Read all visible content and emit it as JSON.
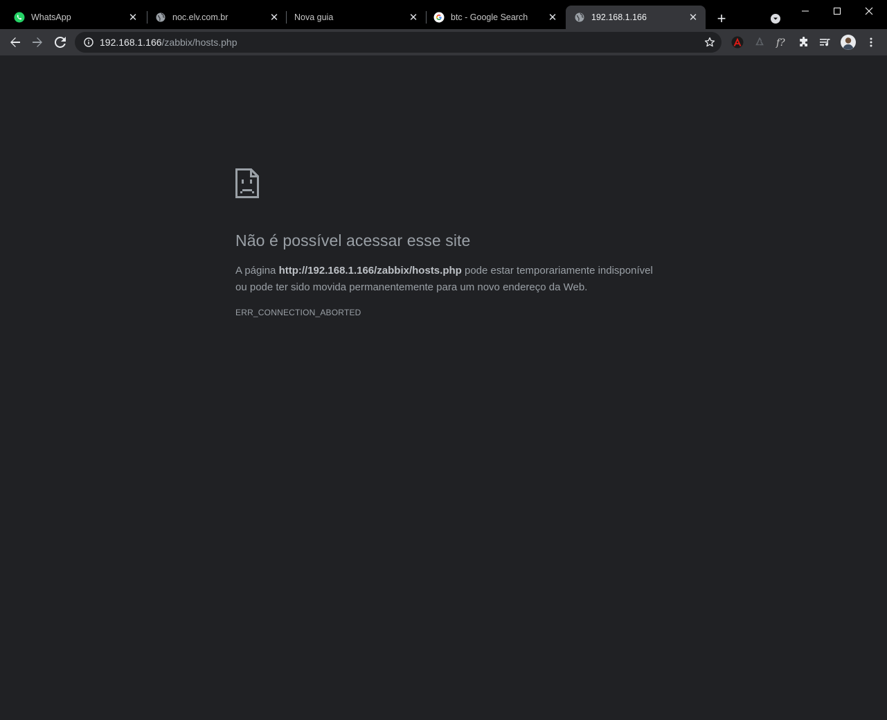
{
  "tabs": [
    {
      "title": "WhatsApp",
      "icon": "whatsapp-icon"
    },
    {
      "title": "noc.elv.com.br",
      "icon": "globe-icon"
    },
    {
      "title": "Nova guia",
      "icon": ""
    },
    {
      "title": "btc - Google Search",
      "icon": "google-icon"
    },
    {
      "title": "192.168.1.166",
      "icon": "globe-icon",
      "active": true
    }
  ],
  "new_tab_label": "+",
  "address": {
    "host": "192.168.1.166",
    "path": "/zabbix/hosts.php"
  },
  "error": {
    "title": "Não é possível acessar esse site",
    "body_prefix": "A página ",
    "url": "http://192.168.1.166/zabbix/hosts.php",
    "body_suffix": " pode estar temporariamente indisponível ou pode ter sido movida permanentemente para um novo endereço da Web.",
    "code": "ERR_CONNECTION_ABORTED"
  },
  "colors": {
    "background": "#202124",
    "toolbar": "#35363a",
    "tabstrip": "#000000",
    "text_secondary": "#9aa0a6",
    "whatsapp_green": "#25d366"
  }
}
